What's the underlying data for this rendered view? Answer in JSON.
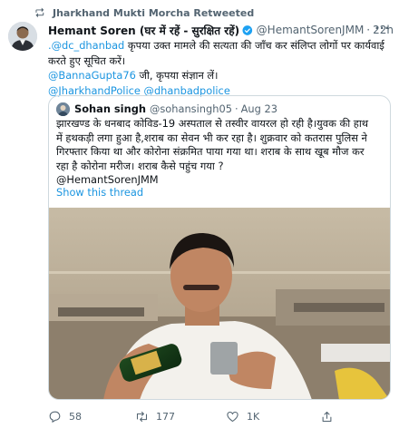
{
  "retweet": {
    "label": "Jharkhand Mukti Morcha Retweeted"
  },
  "tweet": {
    "name": "Hemant Soren (घर में रहें - सुरक्षित रहें)",
    "handle": "@HemantSorenJMM",
    "separator": "·",
    "time": "22h",
    "more": "···",
    "line1_mention": ".@dc_dhanbad",
    "line1_text": " कृपया उक्त मामले की सत्यता की जाँच कर संलिप्त लोगों पर कार्यवाई",
    "line2_text": "करते हुए सूचित करें।",
    "line3_mention": "@BannaGupta76",
    "line3_text": " जी, कृपया संज्ञान लें।",
    "line4_mention1": "@JharkhandPolice",
    "line4_mention2": "@dhanbadpolice"
  },
  "quote": {
    "name": "Sohan singh",
    "handle": "@sohansingh05",
    "separator": "·",
    "time": "Aug 23",
    "text_line1": "झारखण्ड के धनबाद कोविड-19 अस्पताल से तस्वीर वायरल हो रही है।युवक की हाथ",
    "text_line2": "में हथकड़ी लगा हुआ है,शराब का सेवन भी कर रहा है। शुक्रवार को कतरास पुलिस ने",
    "text_line3": "गिरफ्तार किया था और कोरोना संक्रमित पाया गया था। शराब के साथ खूब मौज कर",
    "text_line4": "रहा है कोरोना मरीज। शराब कैसे पहुंच गया ?",
    "text_line5": "@HemantSorenJMM",
    "show_thread": "Show this thread"
  },
  "actions": {
    "replies": "58",
    "retweets": "177",
    "likes": "1K"
  },
  "colors": {
    "link": "#1b95e0",
    "secondary_text": "#536471",
    "verified": "#1da1f2"
  }
}
